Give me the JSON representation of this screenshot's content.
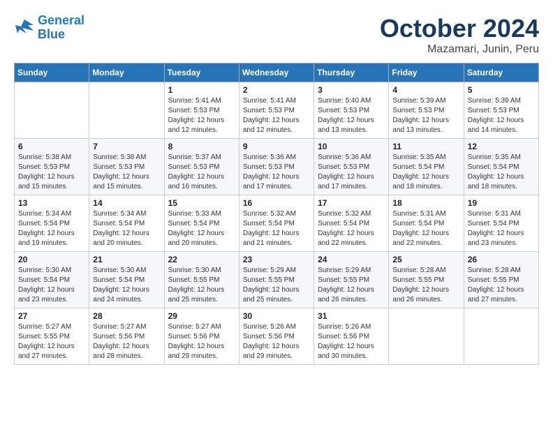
{
  "header": {
    "logo_line1": "General",
    "logo_line2": "Blue",
    "month": "October 2024",
    "location": "Mazamari, Junin, Peru"
  },
  "weekdays": [
    "Sunday",
    "Monday",
    "Tuesday",
    "Wednesday",
    "Thursday",
    "Friday",
    "Saturday"
  ],
  "weeks": [
    [
      {
        "day": null,
        "info": null
      },
      {
        "day": null,
        "info": null
      },
      {
        "day": "1",
        "info": "Sunrise: 5:41 AM\nSunset: 5:53 PM\nDaylight: 12 hours\nand 12 minutes."
      },
      {
        "day": "2",
        "info": "Sunrise: 5:41 AM\nSunset: 5:53 PM\nDaylight: 12 hours\nand 12 minutes."
      },
      {
        "day": "3",
        "info": "Sunrise: 5:40 AM\nSunset: 5:53 PM\nDaylight: 12 hours\nand 13 minutes."
      },
      {
        "day": "4",
        "info": "Sunrise: 5:39 AM\nSunset: 5:53 PM\nDaylight: 12 hours\nand 13 minutes."
      },
      {
        "day": "5",
        "info": "Sunrise: 5:39 AM\nSunset: 5:53 PM\nDaylight: 12 hours\nand 14 minutes."
      }
    ],
    [
      {
        "day": "6",
        "info": "Sunrise: 5:38 AM\nSunset: 5:53 PM\nDaylight: 12 hours\nand 15 minutes."
      },
      {
        "day": "7",
        "info": "Sunrise: 5:38 AM\nSunset: 5:53 PM\nDaylight: 12 hours\nand 15 minutes."
      },
      {
        "day": "8",
        "info": "Sunrise: 5:37 AM\nSunset: 5:53 PM\nDaylight: 12 hours\nand 16 minutes."
      },
      {
        "day": "9",
        "info": "Sunrise: 5:36 AM\nSunset: 5:53 PM\nDaylight: 12 hours\nand 17 minutes."
      },
      {
        "day": "10",
        "info": "Sunrise: 5:36 AM\nSunset: 5:53 PM\nDaylight: 12 hours\nand 17 minutes."
      },
      {
        "day": "11",
        "info": "Sunrise: 5:35 AM\nSunset: 5:54 PM\nDaylight: 12 hours\nand 18 minutes."
      },
      {
        "day": "12",
        "info": "Sunrise: 5:35 AM\nSunset: 5:54 PM\nDaylight: 12 hours\nand 18 minutes."
      }
    ],
    [
      {
        "day": "13",
        "info": "Sunrise: 5:34 AM\nSunset: 5:54 PM\nDaylight: 12 hours\nand 19 minutes."
      },
      {
        "day": "14",
        "info": "Sunrise: 5:34 AM\nSunset: 5:54 PM\nDaylight: 12 hours\nand 20 minutes."
      },
      {
        "day": "15",
        "info": "Sunrise: 5:33 AM\nSunset: 5:54 PM\nDaylight: 12 hours\nand 20 minutes."
      },
      {
        "day": "16",
        "info": "Sunrise: 5:32 AM\nSunset: 5:54 PM\nDaylight: 12 hours\nand 21 minutes."
      },
      {
        "day": "17",
        "info": "Sunrise: 5:32 AM\nSunset: 5:54 PM\nDaylight: 12 hours\nand 22 minutes."
      },
      {
        "day": "18",
        "info": "Sunrise: 5:31 AM\nSunset: 5:54 PM\nDaylight: 12 hours\nand 22 minutes."
      },
      {
        "day": "19",
        "info": "Sunrise: 5:31 AM\nSunset: 5:54 PM\nDaylight: 12 hours\nand 23 minutes."
      }
    ],
    [
      {
        "day": "20",
        "info": "Sunrise: 5:30 AM\nSunset: 5:54 PM\nDaylight: 12 hours\nand 23 minutes."
      },
      {
        "day": "21",
        "info": "Sunrise: 5:30 AM\nSunset: 5:54 PM\nDaylight: 12 hours\nand 24 minutes."
      },
      {
        "day": "22",
        "info": "Sunrise: 5:30 AM\nSunset: 5:55 PM\nDaylight: 12 hours\nand 25 minutes."
      },
      {
        "day": "23",
        "info": "Sunrise: 5:29 AM\nSunset: 5:55 PM\nDaylight: 12 hours\nand 25 minutes."
      },
      {
        "day": "24",
        "info": "Sunrise: 5:29 AM\nSunset: 5:55 PM\nDaylight: 12 hours\nand 26 minutes."
      },
      {
        "day": "25",
        "info": "Sunrise: 5:28 AM\nSunset: 5:55 PM\nDaylight: 12 hours\nand 26 minutes."
      },
      {
        "day": "26",
        "info": "Sunrise: 5:28 AM\nSunset: 5:55 PM\nDaylight: 12 hours\nand 27 minutes."
      }
    ],
    [
      {
        "day": "27",
        "info": "Sunrise: 5:27 AM\nSunset: 5:55 PM\nDaylight: 12 hours\nand 27 minutes."
      },
      {
        "day": "28",
        "info": "Sunrise: 5:27 AM\nSunset: 5:56 PM\nDaylight: 12 hours\nand 28 minutes."
      },
      {
        "day": "29",
        "info": "Sunrise: 5:27 AM\nSunset: 5:56 PM\nDaylight: 12 hours\nand 29 minutes."
      },
      {
        "day": "30",
        "info": "Sunrise: 5:26 AM\nSunset: 5:56 PM\nDaylight: 12 hours\nand 29 minutes."
      },
      {
        "day": "31",
        "info": "Sunrise: 5:26 AM\nSunset: 5:56 PM\nDaylight: 12 hours\nand 30 minutes."
      },
      {
        "day": null,
        "info": null
      },
      {
        "day": null,
        "info": null
      }
    ]
  ]
}
